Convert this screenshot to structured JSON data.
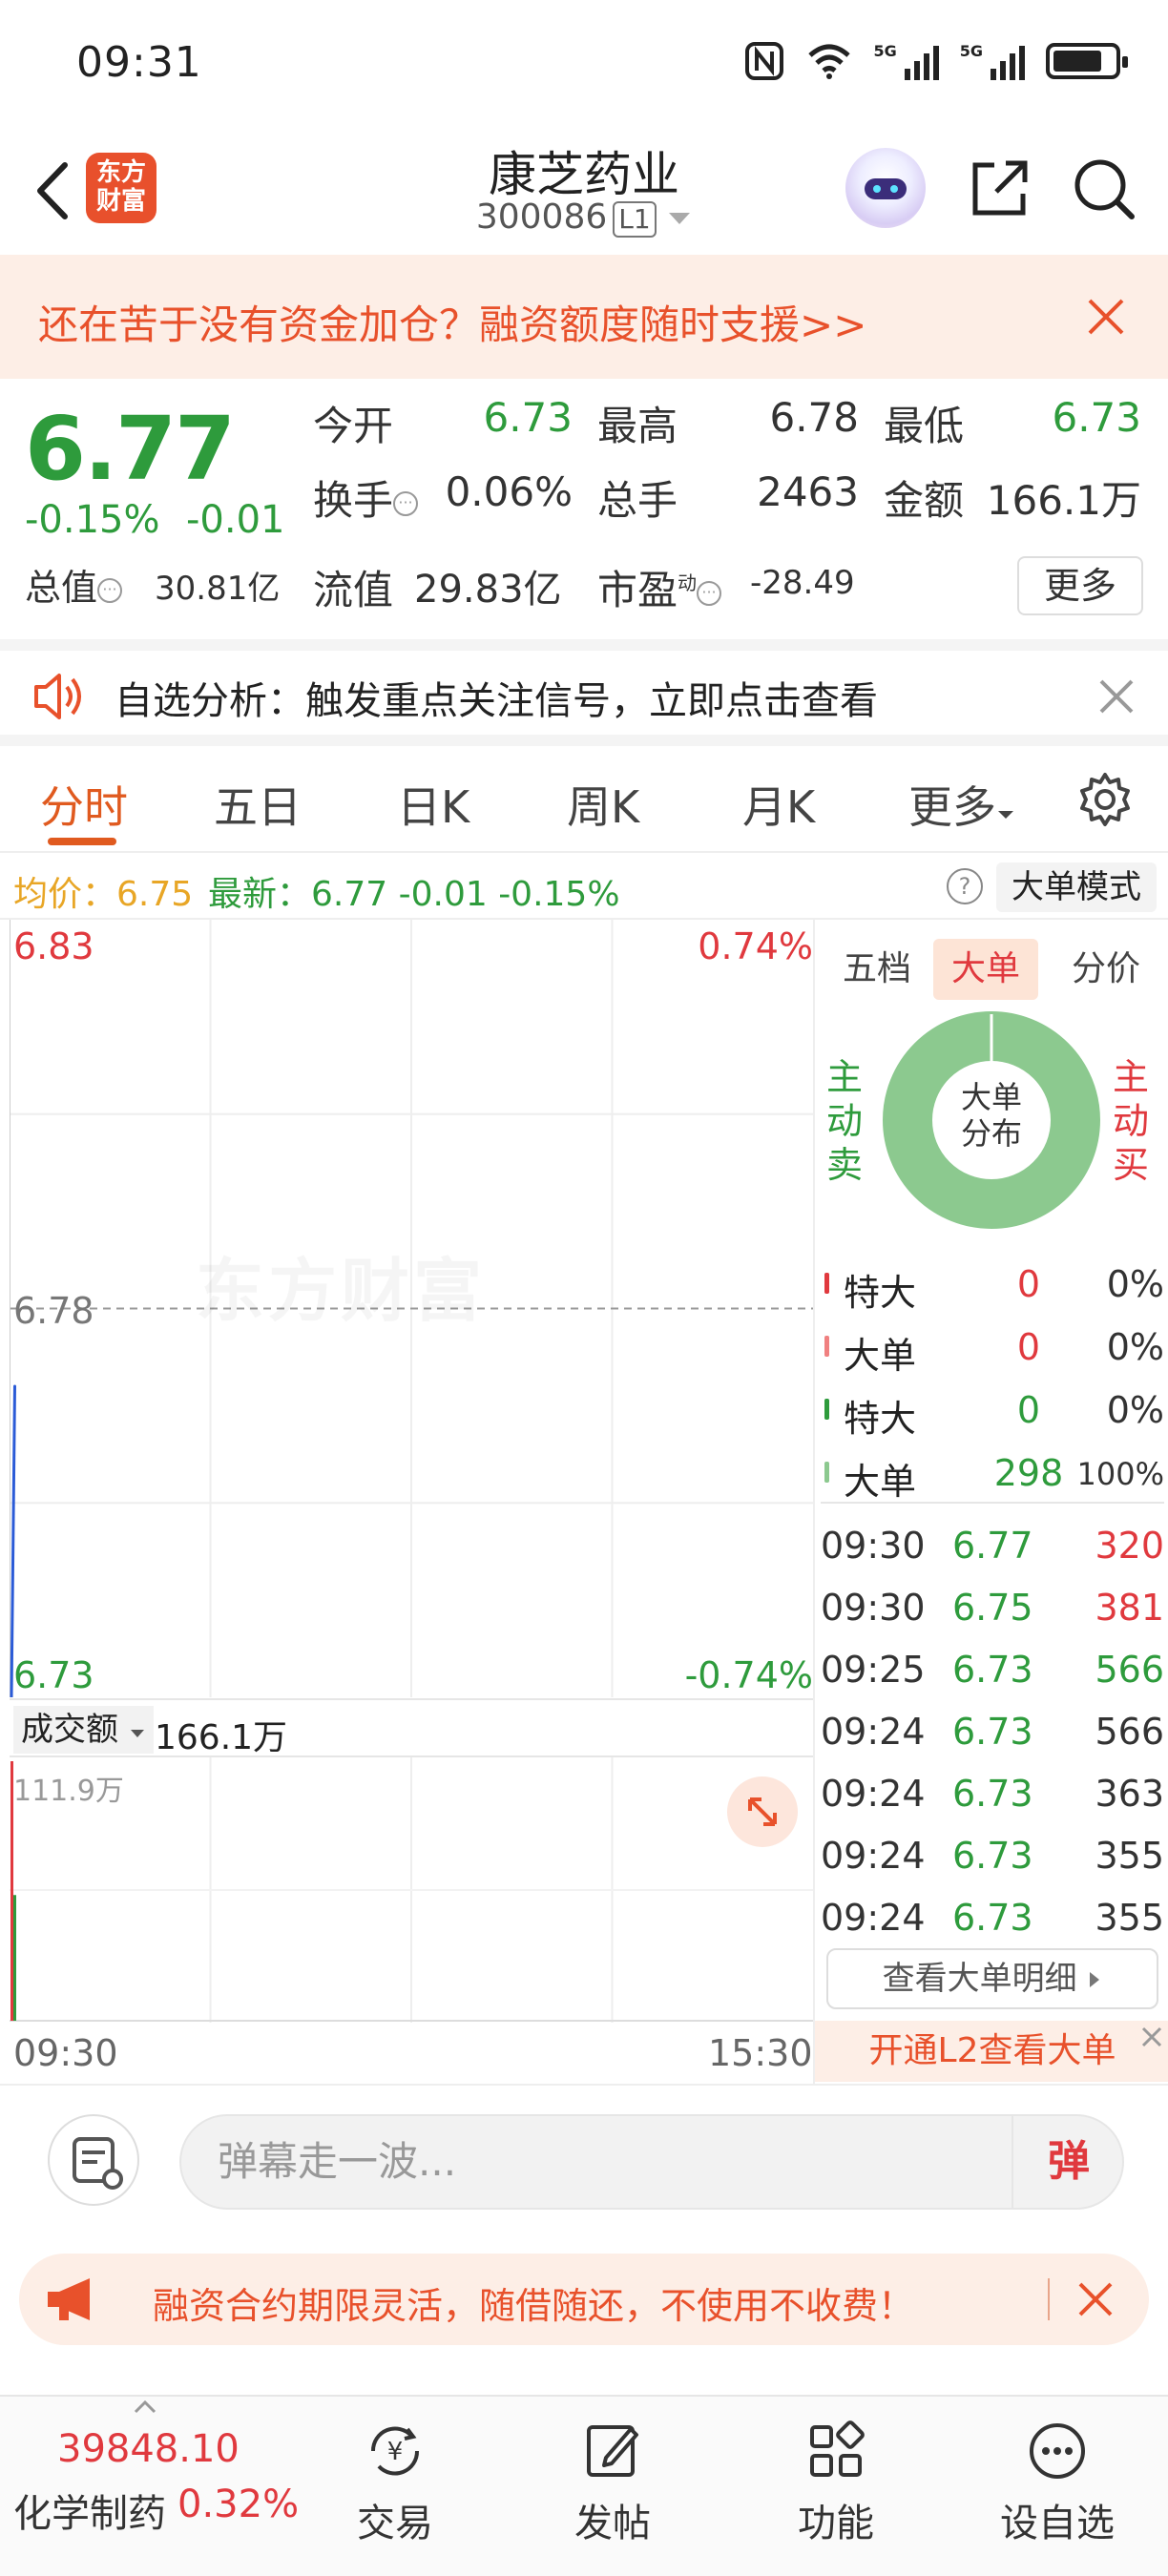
{
  "status_bar": {
    "time": "09:31",
    "sig1": "5G",
    "sig2": "5G"
  },
  "header": {
    "logo_line1": "东方",
    "logo_line2": "财富",
    "stock_name": "康芝药业",
    "stock_code": "300086",
    "level": "L1"
  },
  "promo": {
    "text": "还在苦于没有资金加仓？融资额度随时支援>>"
  },
  "quote": {
    "price": "6.77",
    "change_pct": "-0.15%",
    "change_abs": "-0.01",
    "open_label": "今开",
    "open_value": "6.73",
    "high_label": "最高",
    "high_value": "6.78",
    "low_label": "最低",
    "low_value": "6.73",
    "turnover_label": "换手",
    "turnover_value": "0.06%",
    "volume_label": "总手",
    "volume_value": "2463",
    "amount_label": "金额",
    "amount_value": "166.1万",
    "mktcap_label": "总值",
    "mktcap_value": "30.81亿",
    "float_label": "流值",
    "float_value": "29.83亿",
    "pe_label": "市盈",
    "pe_sup": "动",
    "pe_value": "-28.49",
    "more_label": "更多"
  },
  "analysis": {
    "text": "自选分析：触发重点关注信号，立即点击查看"
  },
  "tabs": [
    "分时",
    "五日",
    "日K",
    "周K",
    "月K",
    "更多"
  ],
  "avg_info": {
    "avg_label": "均价：",
    "avg_value": "6.75",
    "latest_text": "最新：6.77 -0.01 -0.15%",
    "help": "?",
    "mode_button": "大单模式"
  },
  "chart": {
    "price_high": "6.83",
    "price_low": "6.73",
    "price_mid": "6.78",
    "pct_high": "0.74%",
    "pct_low": "-0.74%",
    "watermark": "东方财富",
    "volume_label": "成交额",
    "volume_total": "166.1万",
    "volume_max": "111.9万",
    "time_start": "09:30",
    "time_end": "15:30"
  },
  "chart_data": {
    "type": "line",
    "xlabel": "",
    "ylabel": "",
    "ylim": [
      6.73,
      6.83
    ],
    "x": [
      "09:30",
      "09:31"
    ],
    "series": [
      {
        "values": [
          6.73,
          6.77
        ]
      }
    ],
    "volume": {
      "ylim": [
        0,
        111.9
      ],
      "values": [
        111.9,
        54.2
      ]
    }
  },
  "right_panel": {
    "tabs": [
      "五档",
      "大单",
      "分价"
    ],
    "sell_label": "主动卖",
    "buy_label": "主动买",
    "donut_center_1": "大单",
    "donut_center_2": "分布",
    "donut": {
      "sell_pct": 100,
      "buy_pct": 0
    },
    "dist": [
      {
        "label": "特大",
        "count": "0",
        "pct": "0%",
        "color": "#e0393e"
      },
      {
        "label": "大单",
        "count": "0",
        "pct": "0%",
        "color": "#f08080"
      },
      {
        "label": "特大",
        "count": "0",
        "pct": "0%",
        "color": "#2e9b3c"
      },
      {
        "label": "大单",
        "count": "298",
        "pct": "100%",
        "color": "#8cc98f"
      }
    ],
    "ticks": [
      {
        "time": "09:30",
        "price": "6.77",
        "vol": "320",
        "vcolor": "#e0393e"
      },
      {
        "time": "09:30",
        "price": "6.75",
        "vol": "381",
        "vcolor": "#e0393e"
      },
      {
        "time": "09:25",
        "price": "6.73",
        "vol": "566",
        "vcolor": "#2e9b3c"
      },
      {
        "time": "09:24",
        "price": "6.73",
        "vol": "566",
        "vcolor": "#333333"
      },
      {
        "time": "09:24",
        "price": "6.73",
        "vol": "363",
        "vcolor": "#333333"
      },
      {
        "time": "09:24",
        "price": "6.73",
        "vol": "355",
        "vcolor": "#333333"
      },
      {
        "time": "09:24",
        "price": "6.73",
        "vol": "355",
        "vcolor": "#333333"
      }
    ],
    "detail_button": "查看大单明细",
    "l2_text": "开通L2查看大单"
  },
  "comment": {
    "placeholder": "弹幕走一波...",
    "send_label": "弹"
  },
  "loan": {
    "text": "融资合约期限灵活，随借随还，不使用不收费！"
  },
  "bottom_nav": {
    "index_value": "39848.10",
    "index_name": "化学制药",
    "index_change": "0.32%",
    "items": [
      "交易",
      "发帖",
      "功能",
      "设自选"
    ]
  },
  "colors": {
    "accent": "#e05a1f",
    "up": "#e0393e",
    "down": "#2e9b3c",
    "avg": "#e8a626"
  }
}
